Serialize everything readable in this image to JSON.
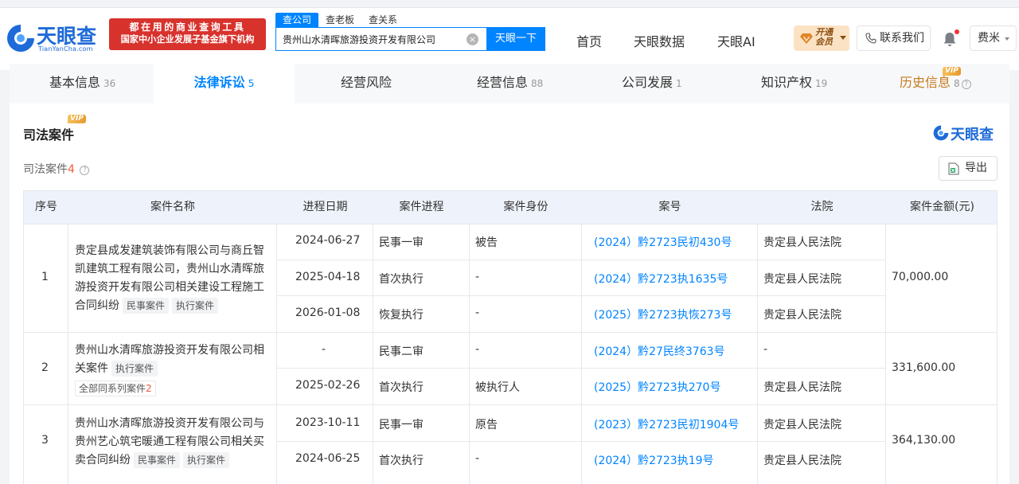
{
  "header": {
    "logo_text": "天眼查",
    "logo_sub": "TianYanCha.com",
    "banner_line1": "都在用的商业查询工具",
    "banner_line2": "国家中小企业发展子基金旗下机构",
    "search_tabs": [
      "查公司",
      "查老板",
      "查关系"
    ],
    "search_value": "贵州山水清晖旅游投资开发有限公司",
    "search_button": "天眼一下",
    "nav": [
      "首页",
      "天眼数据",
      "天眼AI"
    ],
    "vip_label": "开通会员",
    "contact": "联系我们",
    "user": "费米"
  },
  "tabs": [
    {
      "label": "基本信息",
      "count": "36"
    },
    {
      "label": "法律诉讼",
      "count": "5"
    },
    {
      "label": "经营风险",
      "count": ""
    },
    {
      "label": "经营信息",
      "count": "88"
    },
    {
      "label": "公司发展",
      "count": "1"
    },
    {
      "label": "知识产权",
      "count": "19"
    },
    {
      "label": "历史信息",
      "count": "8"
    }
  ],
  "vip_tag": "VIP",
  "section": {
    "title": "司法案件",
    "brand": "天眼查",
    "count_label": "司法案件",
    "count": "4",
    "export": "导出"
  },
  "table": {
    "headers": [
      "序号",
      "案件名称",
      "进程日期",
      "案件进程",
      "案件身份",
      "案号",
      "法院",
      "案件金额(元)"
    ],
    "cases": [
      {
        "no": "1",
        "name": "贵定县成发建筑装饰有限公司与商丘智凯建筑工程有限公司，贵州山水清晖旅游投资开发有限公司相关建设工程施工合同纠纷",
        "name_lines": [
          "贵定县成发建筑装饰有限公司与商丘智",
          "凯建筑工程有限公司，贵州山水清晖旅",
          "游投资开发有限公司相关建设工程施工",
          "合同纠纷"
        ],
        "tags": [
          "民事案件",
          "执行案件"
        ],
        "amount": "70,000.00",
        "rows": [
          {
            "date": "2024-06-27",
            "stage": "民事一审",
            "role": "被告",
            "case_no": "(2024）黔2723民初430号",
            "court": "贵定县人民法院"
          },
          {
            "date": "2025-04-18",
            "stage": "首次执行",
            "role": "-",
            "case_no": "(2024）黔2723执1635号",
            "court": "贵定县人民法院"
          },
          {
            "date": "2026-01-08",
            "stage": "恢复执行",
            "role": "-",
            "case_no": "(2025）黔2723执恢273号",
            "court": "贵定县人民法院"
          }
        ]
      },
      {
        "no": "2",
        "name": "贵州山水清晖旅游投资开发有限公司相关案件",
        "name_lines": [
          "贵州山水清晖旅游投资开发有限公司相",
          "关案件"
        ],
        "tags": [
          "执行案件"
        ],
        "series_label": "全部同系列案件",
        "series_count": "2",
        "amount": "331,600.00",
        "rows": [
          {
            "date": "-",
            "stage": "民事二审",
            "role": "-",
            "case_no": "(2024）黔27民终3763号",
            "court": "-"
          },
          {
            "date": "2025-02-26",
            "stage": "首次执行",
            "role": "被执行人",
            "case_no": "(2025）黔2723执270号",
            "court": "贵定县人民法院"
          }
        ]
      },
      {
        "no": "3",
        "name": "贵州山水清晖旅游投资开发有限公司与贵州艺心筑宅暖通工程有限公司相关买卖合同纠纷",
        "name_lines": [
          "贵州山水清晖旅游投资开发有限公司与",
          "贵州艺心筑宅暖通工程有限公司相关买",
          "卖合同纠纷"
        ],
        "tags": [
          "民事案件",
          "执行案件"
        ],
        "amount": "364,130.00",
        "rows": [
          {
            "date": "2023-10-11",
            "stage": "民事一审",
            "role": "原告",
            "case_no": "(2023）黔2723民初1904号",
            "court": "贵定县人民法院"
          },
          {
            "date": "2024-06-25",
            "stage": "首次执行",
            "role": "-",
            "case_no": "(2024）黔2723执19号",
            "court": "贵定县人民法院"
          }
        ]
      }
    ]
  },
  "colors": {
    "primary": "#0084ff",
    "brand_blue": "#1e6ad8",
    "banner_red": "#d8322d",
    "accent_orange": "#ee5b3c"
  }
}
